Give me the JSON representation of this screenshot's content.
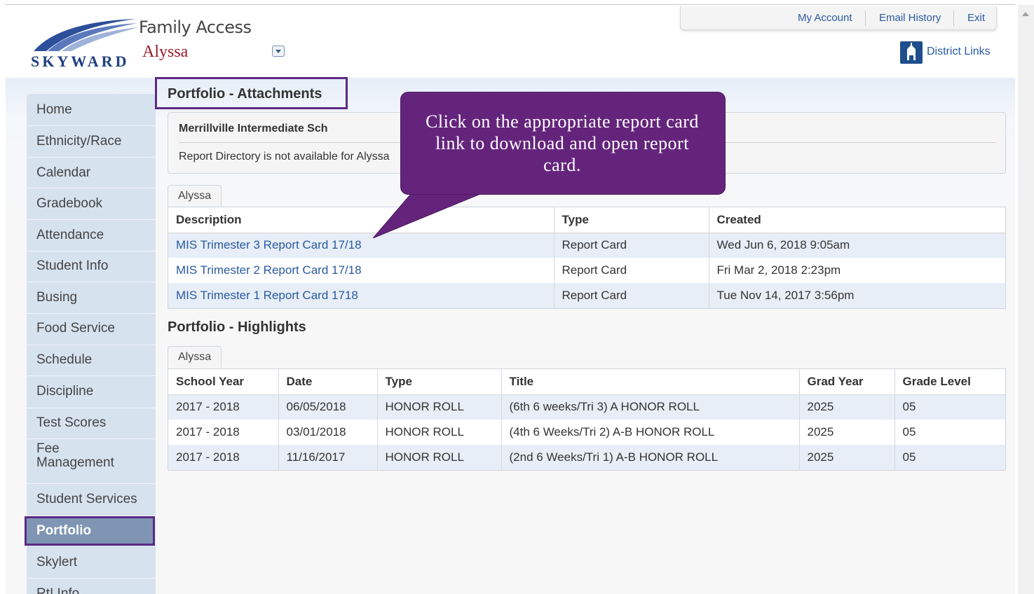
{
  "header": {
    "logo_text": "SKYWARD",
    "app_title": "Family Access",
    "student_name": "Alyssa",
    "account_links": [
      "My Account",
      "Email History",
      "Exit"
    ],
    "district_links": "District Links"
  },
  "sidebar": {
    "items": [
      {
        "label": "Home"
      },
      {
        "label": "Ethnicity/Race"
      },
      {
        "label": "Calendar"
      },
      {
        "label": "Gradebook"
      },
      {
        "label": "Attendance"
      },
      {
        "label": "Student Info"
      },
      {
        "label": "Busing"
      },
      {
        "label": "Food Service"
      },
      {
        "label": "Schedule"
      },
      {
        "label": "Discipline"
      },
      {
        "label": "Test Scores"
      },
      {
        "label": "Fee Management"
      },
      {
        "label": "Student Services"
      },
      {
        "label": "Portfolio",
        "active": true
      },
      {
        "label": "Skylert"
      },
      {
        "label": "RtI Info"
      }
    ]
  },
  "attachments": {
    "title": "Portfolio - Attachments",
    "school": "Merrillville Intermediate Sch",
    "message": "Report Directory is not available for Alyssa",
    "tab": "Alyssa",
    "columns": [
      "Description",
      "Type",
      "Created"
    ],
    "rows": [
      {
        "description": "MIS Trimester 3 Report Card 17/18",
        "type": "Report Card",
        "created": "Wed Jun 6, 2018 9:05am"
      },
      {
        "description": "MIS Trimester 2 Report Card 17/18",
        "type": "Report Card",
        "created": "Fri Mar 2, 2018 2:23pm"
      },
      {
        "description": "MIS Trimester 1 Report Card 1718",
        "type": "Report Card",
        "created": "Tue Nov 14, 2017 3:56pm"
      }
    ]
  },
  "highlights": {
    "title": "Portfolio - Highlights",
    "tab": "Alyssa",
    "columns": [
      "School Year",
      "Date",
      "Type",
      "Title",
      "Grad Year",
      "Grade Level"
    ],
    "rows": [
      {
        "school_year": "2017 - 2018",
        "date": "06/05/2018",
        "type": "HONOR ROLL",
        "title": "(6th 6 weeks/Tri 3) A HONOR ROLL",
        "grad_year": "2025",
        "grade_level": "05"
      },
      {
        "school_year": "2017 - 2018",
        "date": "03/01/2018",
        "type": "HONOR ROLL",
        "title": "(4th 6 Weeks/Tri 2) A-B HONOR ROLL",
        "grad_year": "2025",
        "grade_level": "05"
      },
      {
        "school_year": "2017 - 2018",
        "date": "11/16/2017",
        "type": "HONOR ROLL",
        "title": "(2nd 6 Weeks/Tri 1) A-B HONOR ROLL",
        "grad_year": "2025",
        "grade_level": "05"
      }
    ]
  },
  "callout": {
    "text": "Click on the appropriate report card link to download and open report card."
  },
  "colors": {
    "accent_purple": "#5b2a86",
    "callout_purple": "#64247c",
    "link_blue": "#2a5aa0",
    "student_red": "#9c1b2a"
  }
}
